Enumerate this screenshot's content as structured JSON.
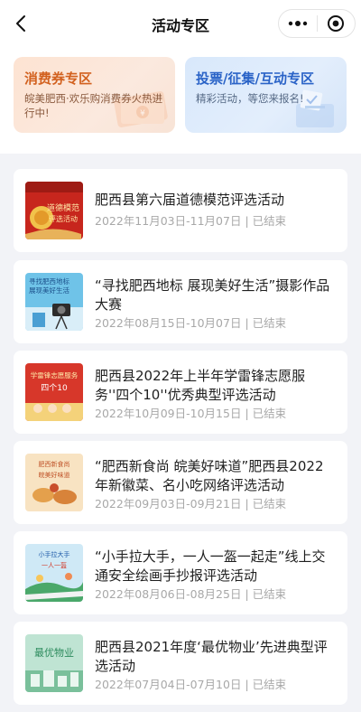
{
  "nav": {
    "title": "活动专区"
  },
  "features": [
    {
      "title": "消费券专区",
      "subtitle": "皖美肥西·欢乐购消费券火热进行中!"
    },
    {
      "title": "投票/征集/互动专区",
      "subtitle": "精彩活动，等您来报名!"
    }
  ],
  "activities": [
    {
      "title": "肥西县第六届道德模范评选活动",
      "date_range": "2022年11月03日-11月07日",
      "status": "已结束",
      "thumb_text": "道德模范评选活动"
    },
    {
      "title": "“寻找肥西地标 展现美好生活”摄影作品大赛",
      "date_range": "2022年08月15日-10月07日",
      "status": "已结束",
      "thumb_text": "寻找肥西地标 展现美好生活"
    },
    {
      "title": "肥西县2022年上半年学雷锋志愿服务''四个10''优秀典型评选活动",
      "date_range": "2022年10月09日-10月15日",
      "status": "已结束",
      "thumb_text": "学雷锋志愿服务 四个10"
    },
    {
      "title": "“肥西新食尚 皖美好味道”肥西县2022年新徽菜、名小吃网络评选活动",
      "date_range": "2022年09月03日-09月21日",
      "status": "已结束",
      "thumb_text": "肥西新食尚 皖美好味道"
    },
    {
      "title": "“小手拉大手，一人一盔一起走”线上交通安全绘画手抄报评选活动",
      "date_range": "2022年08月06日-08月25日",
      "status": "已结束",
      "thumb_text": "小手拉大手 一人一盔一起走"
    },
    {
      "title": "肥西县2021年度‘最优物业’先进典型评选活动",
      "date_range": "2022年07月04日-07月10日",
      "status": "已结束",
      "thumb_text": "最优物业"
    }
  ]
}
